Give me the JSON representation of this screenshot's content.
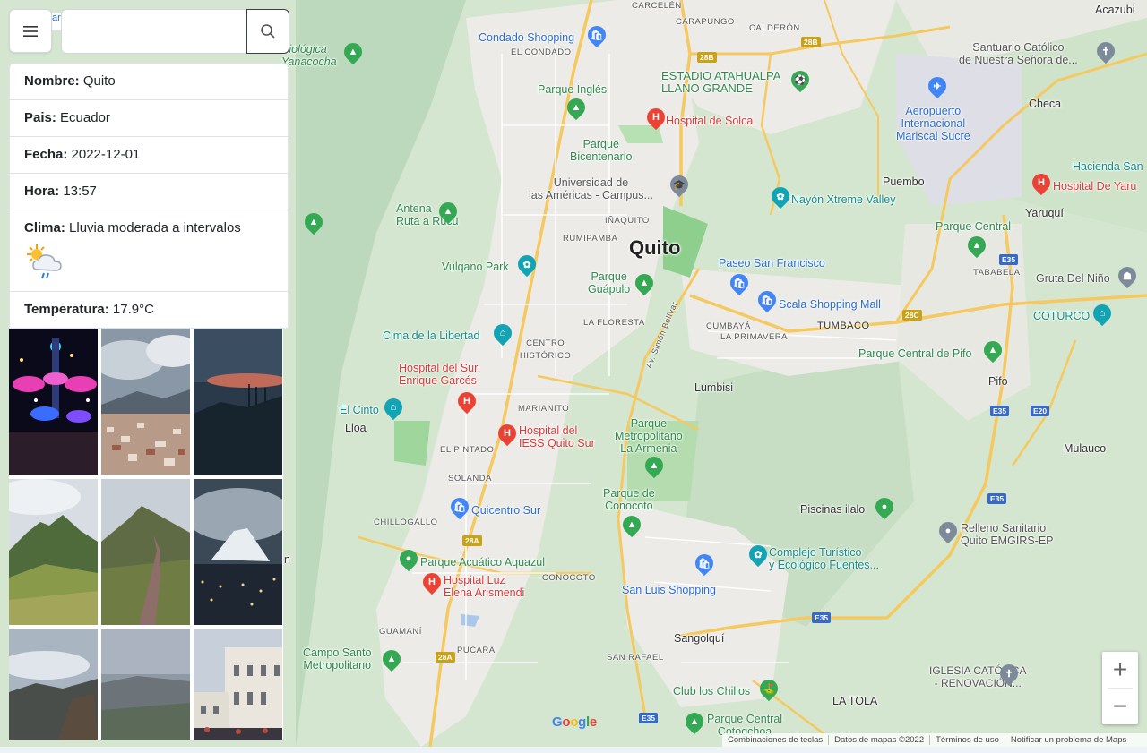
{
  "search": {
    "value": "",
    "placeholder": ""
  },
  "info": {
    "nombre": {
      "label": "Nombre:",
      "value": "Quito"
    },
    "pais": {
      "label": "Pais:",
      "value": "Ecuador"
    },
    "fecha": {
      "label": "Fecha:",
      "value": "2022-12-01"
    },
    "hora": {
      "label": "Hora:",
      "value": "13:57"
    },
    "clima": {
      "label": "Clima:",
      "value": "Lluvia moderada a intervalos",
      "icon": "sun-cloud-rain-icon"
    },
    "temperatura": {
      "label": "Temperatura:",
      "value": "17.9°C"
    }
  },
  "gallery": {
    "photos": [
      "night-festival-lights",
      "city-hillside-clouds",
      "dusk-antenna-hill",
      "green-mountain-peak",
      "mountain-trail",
      "snow-volcano-night",
      "cloudy-mountain-ridge",
      "hazy-valley",
      "colonial-church-plaza"
    ]
  },
  "map": {
    "city_label": "Quito",
    "places": {
      "condado": "Condado Shopping",
      "biologica": "Biológica\nYanacocha",
      "carcelen": "CARCELÉN",
      "carapungo": "CARAPUNGO",
      "calderon": "CALDERÓN",
      "el_condado": "EL CONDADO",
      "estadio": "ESTADIO ATAHUALPA\nLLANO GRANDE",
      "parque_ingles": "Parque Inglés",
      "hospital_solca": "Hospital de Solca",
      "parque_bicentenario": "Parque\nBicentenario",
      "universidad": "Universidad de\nlas Américas - Campus...",
      "inaquito": "IÑAQUITO",
      "rumipamba": "RUMIPAMBA",
      "antena": "Antena\nRuta a Rucu",
      "vulqano": "Vulqano Park",
      "parque_guapulo": "Parque\nGuápulo",
      "paseo_sf": "Paseo San Francisco",
      "scala": "Scala Shopping Mall",
      "nayon": "Nayón Xtreme Valley",
      "tumbaco": "TUMBACO",
      "cumbaya": "CUMBAYÁ",
      "la_primavera": "LA PRIMAVERA",
      "la_floresta": "LA FLORESTA",
      "av_simon": "Av. Simón Bolívar",
      "cima": "Cima de la Libertad",
      "centro": "CENTRO\nHISTÓRICO",
      "hospital_sur": "Hospital del Sur\nEnrique Garcés",
      "lumbisi": "Lumbisi",
      "el_cinto": "El Cinto",
      "loa": "Lloa",
      "marianito": "MARIANITO",
      "hospital_iess": "Hospital del\nIESS Quito Sur",
      "parque_metro": "Parque\nMetropolitano\nLa Armenia",
      "el_pintado": "EL PINTADO",
      "solanda": "SOLANDA",
      "parque_conocoto": "Parque de\nConocoto",
      "quicentro": "Quicentro Sur",
      "chillogallo": "CHILLOGALLO",
      "aquazul": "Parque Acuático Aquazul",
      "conocoto": "CONOCOTO",
      "hospital_luz": "Hospital Luz\nElena Arismendi",
      "san_luis": "San Luis Shopping",
      "complejo": "Complejo Turístico\ny Ecológico Fuentes...",
      "piscinas": "Piscinas ilalo",
      "guamani": "GUAMANÍ",
      "pucara": "PUCARÁ",
      "san_rafael": "SAN RAFAEL",
      "sangolqui": "Sangolquí",
      "campo_santo": "Campo Santo\nMetropolitano",
      "club_chillos": "Club los Chillos",
      "parque_cotogchoa": "Parque Central\nCotogchoa",
      "iglesia": "IGLESIA CATÓLICA\n- RENOVACIÓN...",
      "la_tola": "LA TOLA",
      "relleno": "Relleno Sanitario\nQuito EMGIRS-EP",
      "mulauco": "Mulauco",
      "pifo": "Pifo",
      "parque_pifo": "Parque Central de Pifo",
      "coturco": "COTURCO",
      "gruta": "Gruta Del Niño",
      "tababela": "TABABELA",
      "parque_central": "Parque Central",
      "yaruqui": "Yaruquí",
      "hospital_yaruqui": "Hospital De Yaru",
      "hacienda": "Hacienda San",
      "puembo": "Puembo",
      "aeropuerto": "Aeropuerto\nInternacional\nMariscal Sucre",
      "checa": "Checa",
      "santuario": "Santuario Católico\nde Nuestra Señora de...",
      "acazubi": "Acazubi"
    },
    "shields": [
      "28B",
      "28B",
      "28C",
      "28A",
      "28A",
      "E35",
      "E35",
      "E20",
      "E35",
      "E35",
      "E35"
    ],
    "google": "Google",
    "footer": {
      "shortcuts": "Combinaciones de teclas",
      "data": "Datos de mapas ©2022",
      "terms": "Términos de uso",
      "report": "Notificar un problema de Maps"
    }
  }
}
